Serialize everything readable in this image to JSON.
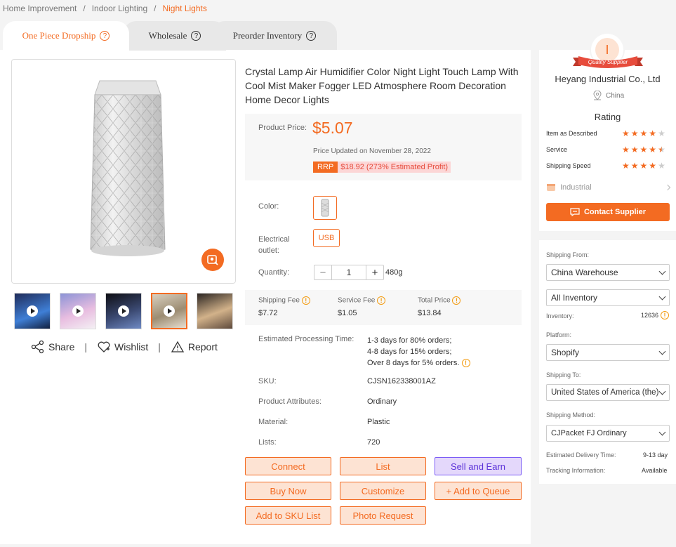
{
  "breadcrumb": {
    "items": [
      "Home Improvement",
      "Indoor Lighting",
      "Night Lights"
    ],
    "separator": "/"
  },
  "tabs": [
    {
      "label": "One Piece Dropship",
      "active": true
    },
    {
      "label": "Wholesale",
      "active": false
    },
    {
      "label": "Preorder Inventory",
      "active": false
    }
  ],
  "product": {
    "title": "Crystal Lamp Air Humidifier Color Night Light Touch Lamp With Cool Mist Maker Fogger LED Atmosphere Room Decoration Home Decor Lights",
    "price_label": "Product Price:",
    "price": "$5.07",
    "price_updated": "Price Updated on November 28, 2022",
    "rrp_tag": "RRP",
    "rrp_value": "$18.92 (273% Estimated Profit)",
    "color_label": "Color:",
    "outlet_label": "Electrical outlet:",
    "outlet_value": "USB",
    "quantity_label": "Quantity:",
    "quantity": "1",
    "weight": "480g",
    "minus": "−",
    "plus": "+"
  },
  "fees": {
    "shipping_label": "Shipping Fee",
    "shipping": "$7.72",
    "service_label": "Service Fee",
    "service": "$1.05",
    "total_label": "Total Price",
    "total": "$13.84"
  },
  "details": {
    "processing_label": "Estimated Processing Time:",
    "processing": [
      "1-3 days for 80% orders;",
      "4-8 days for 15% orders;",
      "Over 8 days for 5% orders."
    ],
    "sku_label": "SKU:",
    "sku": "CJSN162338001AZ",
    "attr_label": "Product Attributes:",
    "attr": "Ordinary",
    "material_label": "Material:",
    "material": "Plastic",
    "lists_label": "Lists:",
    "lists": "720"
  },
  "buttons": {
    "connect": "Connect",
    "list": "List",
    "sell": "Sell and Earn",
    "buy": "Buy Now",
    "customize": "Customize",
    "queue": "+ Add to Queue",
    "sku_list": "Add to SKU List",
    "photo": "Photo Request"
  },
  "actions": {
    "share": "Share",
    "wishlist": "Wishlist",
    "report": "Report",
    "sep": "|"
  },
  "supplier": {
    "avatar_letter": "I",
    "ribbon": "Quality Supplier",
    "name": "Heyang Industrial Co., Ltd",
    "location": "China",
    "rating_title": "Rating",
    "ratings": [
      {
        "label": "Item as Described",
        "stars": 4
      },
      {
        "label": "Service",
        "stars": 4.5
      },
      {
        "label": "Shipping Speed",
        "stars": 4
      }
    ],
    "category": "Industrial",
    "contact": "Contact Supplier"
  },
  "shipping": {
    "from_label": "Shipping From:",
    "from": "China Warehouse",
    "inventory_type": "All Inventory",
    "inventory_label": "Inventory:",
    "inventory": "12636",
    "platform_label": "Platform:",
    "platform": "Shopify",
    "to_label": "Shipping To:",
    "to": "United States of America (the)",
    "method_label": "Shipping Method:",
    "method": "CJPacket FJ Ordinary",
    "delivery_label": "Estimated Delivery Time:",
    "delivery": "9-13 day",
    "tracking_label": "Tracking Information:",
    "tracking": "Available"
  },
  "colors": {
    "accent": "#f36b22",
    "purple": "#7b5cf5",
    "rrp_bg": "#fcd6d6"
  }
}
